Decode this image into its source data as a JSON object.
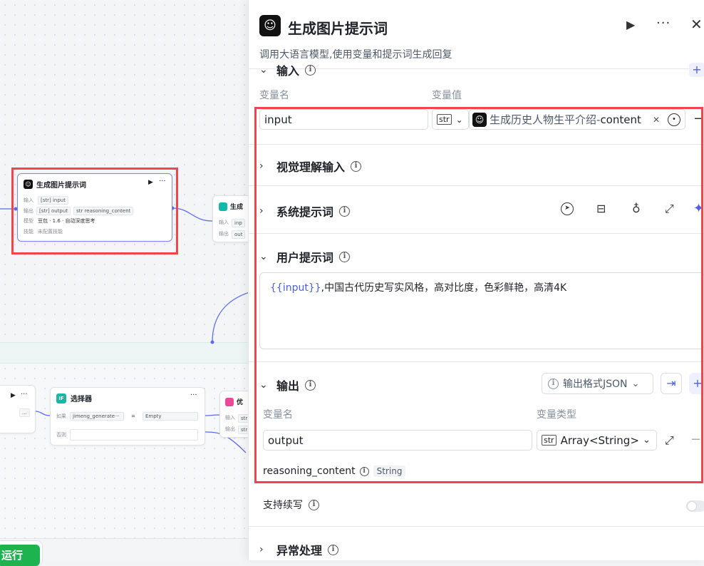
{
  "canvas": {
    "main_node": {
      "title": "生成图片提示词",
      "input_label": "输入",
      "input_type": "[str]",
      "input_value": "input",
      "output_label": "输出",
      "output_type": "[str]",
      "output_value": "output",
      "output2_type": "str",
      "output2_value": "reasoning_content",
      "model_label": "模型",
      "model_value": "豆包 · 1.6 · 自动深度思考",
      "skill_label": "技能",
      "skill_value": "未配置技能"
    },
    "right_node": {
      "title": "生成",
      "input_label": "输入",
      "input_value": "inp",
      "output_label": "输出",
      "output_value": "out"
    },
    "left_node": {
      "tag": "str",
      "more": "..."
    },
    "selector_node": {
      "icon": "IF",
      "title": "选择器",
      "if_label": "如果",
      "if_value": "jimeng_generate···",
      "operator": "=",
      "compare": "Empty",
      "else_label": "否则"
    },
    "opt_node": {
      "title": "优",
      "input_label": "输入",
      "input_tag": "str",
      "output_label": "输出",
      "output_tag": "str"
    },
    "run_button": "运行"
  },
  "panel": {
    "title": "生成图片提示词",
    "description": "调用大语言模型,使用变量和提示词生成回复",
    "input_section": {
      "title": "输入",
      "col_name": "变量名",
      "col_value": "变量值",
      "var_name": "input",
      "var_type": "str",
      "ref_source": "生成历史人物生平介绍",
      "ref_sep": " - ",
      "ref_field": "content"
    },
    "vision_section": {
      "title": "视觉理解输入"
    },
    "system_section": {
      "title": "系统提示词"
    },
    "user_section": {
      "title": "用户提示词",
      "var_ref": "{{input}}",
      "prompt_text": ",中国古代历史写实风格，高对比度，色彩鲜艳，高清4K"
    },
    "output_section": {
      "title": "输出",
      "format_label": "输出格式JSON",
      "col_name": "变量名",
      "col_type": "变量类型",
      "var_name": "output",
      "var_type_tag": "str",
      "var_type": "Array<String>",
      "reasoning_name": "reasoning_content",
      "reasoning_type": "String"
    },
    "continue_label": "支持续写",
    "exception_section": {
      "title": "异常处理"
    }
  },
  "colors": {
    "accent": "#4c5fe8",
    "highlight": "#f2444b",
    "run_green": "#1db34f"
  }
}
